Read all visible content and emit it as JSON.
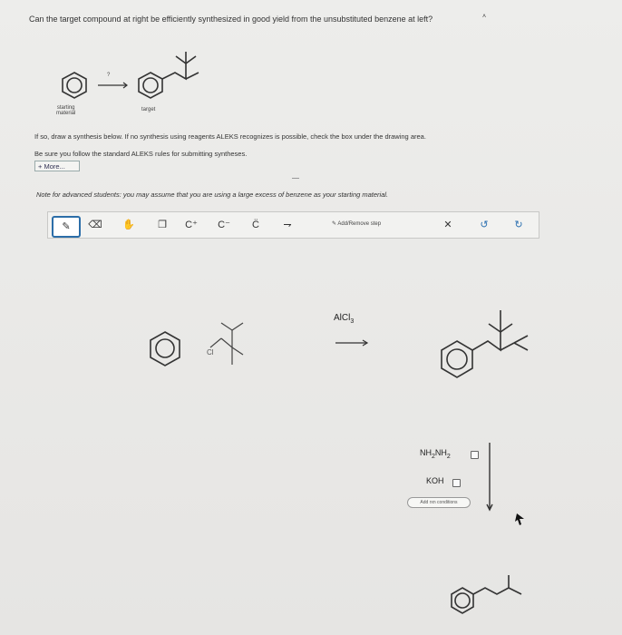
{
  "question": "Can the target compound at right be efficiently synthesized in good yield from the unsubstituted benzene at left?",
  "labels": {
    "starting": "starting\nmaterial",
    "starting_line1": "starting",
    "starting_line2": "material",
    "target": "target",
    "arrow_q": "?"
  },
  "instructions": {
    "line1": "If so, draw a synthesis below. If no synthesis using reagents ALEKS recognizes is possible, check the box under the drawing area.",
    "line2": "Be sure you follow the standard ALEKS rules for submitting syntheses.",
    "more": "More..."
  },
  "note": "Note for advanced students: you may assume that you are using a large excess of benzene as your starting material.",
  "toolbar": {
    "add_remove_step": "Add/Remove step",
    "c_plus": "C⁺",
    "c_minus": "C⁻",
    "c_radical": "C̈",
    "x": "✕",
    "undo": "↺",
    "redo": "↻"
  },
  "reaction": {
    "reagent1": "AlCl",
    "reagent1_sub": "3",
    "chloride": "Cl",
    "cond1": "NH",
    "cond1_sub1": "2",
    "cond1_mid": "NH",
    "cond1_sub2": "2",
    "cond2": "KOH",
    "add_conditions": "Add rxn conditions"
  }
}
